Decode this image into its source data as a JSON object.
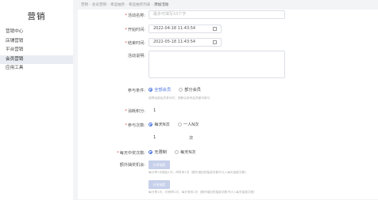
{
  "sidebar": {
    "brand": "营销",
    "items": [
      {
        "label": "营销中心",
        "active": false
      },
      {
        "label": "店铺营销",
        "active": false
      },
      {
        "label": "平台营销",
        "active": false
      },
      {
        "label": "会员营销",
        "active": true
      },
      {
        "label": "应用工具",
        "active": false
      }
    ]
  },
  "breadcrumb": {
    "items": [
      "营销",
      "会员营销",
      "幸运抽奖",
      "幸运抽奖列表"
    ],
    "separator": "-",
    "current": "添加活动"
  },
  "form": {
    "name": {
      "label": "活动名称:",
      "placeholder": "最多可填写10个字"
    },
    "start": {
      "label": "开始时间:",
      "value": "2022-04-18 11:43:54"
    },
    "end": {
      "label": "结束时间:",
      "value": "2022-05-18 11:43:54"
    },
    "desc": {
      "label": "活动说明:"
    },
    "participants": {
      "label": "参与条件:",
      "options": [
        "全部会员",
        "部分会员"
      ],
      "selected": "全部会员",
      "hint": "选择全部会员参与时，即默认所有会员都可参与"
    },
    "points": {
      "label": "消耗积分:",
      "value": "1"
    },
    "times": {
      "label": "参与次数:",
      "options": [
        "每天N次",
        "一人N次"
      ],
      "selected": "每天N次",
      "value": "1",
      "unit": "次"
    },
    "winning": {
      "label": "每天中奖次数:",
      "options": [
        "无限制",
        "每天N次"
      ],
      "selected": "无限制"
    },
    "extra": {
      "label": "额外抽奖机会:",
      "button1": "分享抽奖",
      "hint1": "每分享1次增加1次，同时间1次（额外增加的抽奖次数不计入每天抽奖次数）",
      "button2": "分享抽奖",
      "hint2": "每分享1次，可获得1次，每天有效1次（额外增加的抽奖次数不计入每天抽奖次数）"
    }
  },
  "colors": {
    "accent": "#4b74e0",
    "required": "#e04b4b",
    "button": "#c7d0ea"
  }
}
